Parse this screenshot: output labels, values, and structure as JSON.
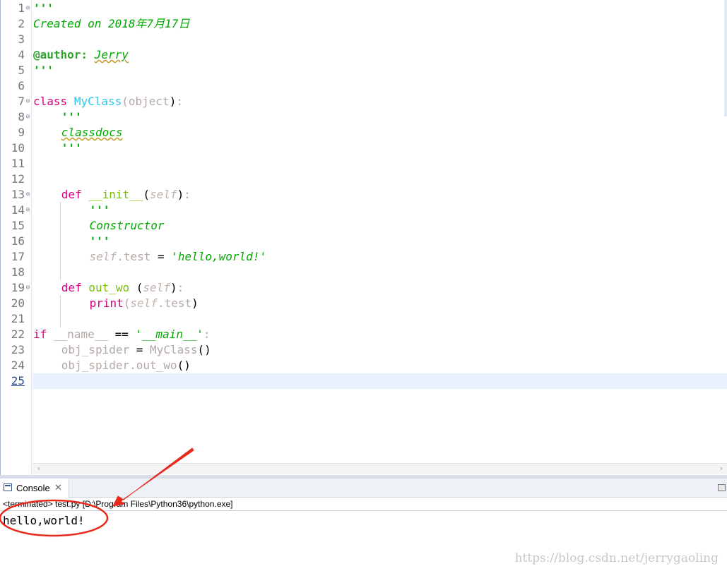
{
  "editor": {
    "line_numbers": [
      "1",
      "2",
      "3",
      "4",
      "5",
      "6",
      "7",
      "8",
      "9",
      "10",
      "11",
      "12",
      "13",
      "14",
      "15",
      "16",
      "17",
      "18",
      "19",
      "20",
      "21",
      "22",
      "23",
      "24",
      "25"
    ],
    "current_line": "25",
    "code": {
      "l1": "'''",
      "l2": "Created on 2018年7月17日",
      "l4_tag": "@author:",
      "l4_name": "Jerry",
      "l5": "'''",
      "l7_kw": "class",
      "l7_name": "MyClass",
      "l7_open": "(",
      "l7_base": "object",
      "l7_close": ")",
      "l7_colon": ":",
      "l8": "'''",
      "l9": "classdocs",
      "l10": "'''",
      "l13_kw": "def",
      "l13_name": "__init__",
      "l13_open": "(",
      "l13_self": "self",
      "l13_close": ")",
      "l13_colon": ":",
      "l14": "'''",
      "l15": "Constructor",
      "l16": "'''",
      "l17_self": "self",
      "l17_attr": ".test",
      "l17_eq": "=",
      "l17_str": "'hello,world!'",
      "l19_kw": "def",
      "l19_name": "out_wo",
      "l19_open": "(",
      "l19_self": "self",
      "l19_close": ")",
      "l19_colon": ":",
      "l20_fn": "print",
      "l20_open": "(",
      "l20_self": "self",
      "l20_attr": ".test",
      "l20_close": ")",
      "l22_kw": "if",
      "l22_name": "__name__",
      "l22_eq": "==",
      "l22_str": "'__main__'",
      "l22_colon": ":",
      "l23_var": "obj_spider",
      "l23_eq": "=",
      "l23_call": "MyClass",
      "l23_parens": "()",
      "l24_var": "obj_spider.out_wo",
      "l24_parens": "()"
    }
  },
  "console": {
    "tab_label": "Console",
    "close_glyph": "✕",
    "icon": "console-icon",
    "status": "<terminated> test.py [D:\\Program Files\\Python36\\python.exe]",
    "output": "hello,world!"
  },
  "watermark": "https://blog.csdn.net/jerrygaoling",
  "colors": {
    "keyword": "#d4007c",
    "string": "#00aa00",
    "class_name": "#28c8e6",
    "function_name": "#74c000",
    "identifier": "#b4a8a4",
    "current_line_bg": "#e8f2fe",
    "annotation": "#e8291c"
  }
}
